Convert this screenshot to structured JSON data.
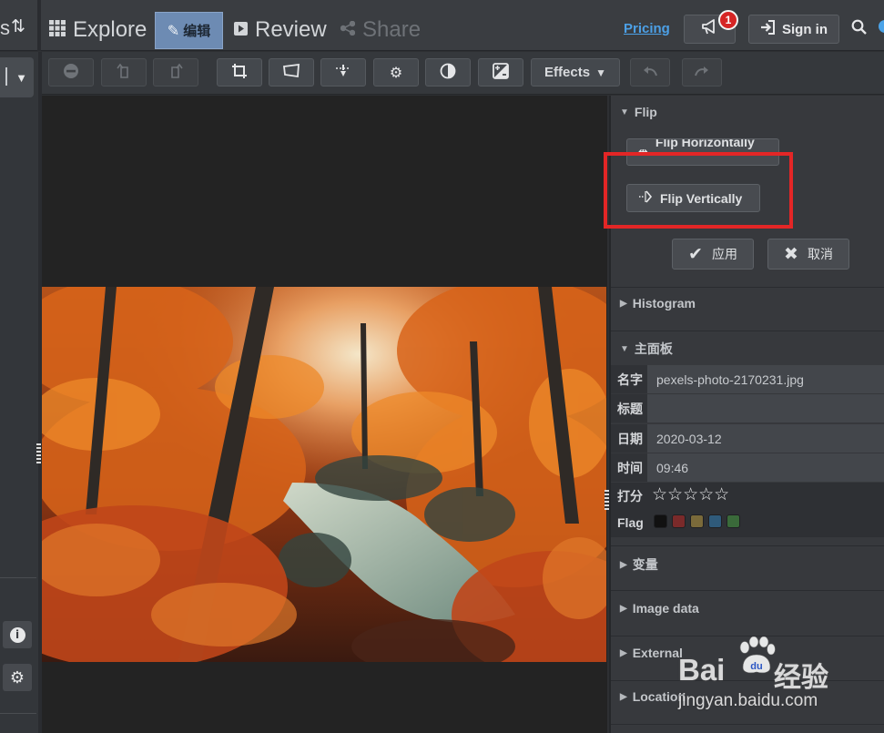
{
  "topbar": {
    "left_fragment": "s",
    "sort_icon": "sort-arrows-icon",
    "nav": [
      {
        "label": "Explore",
        "icon": "grid-icon"
      },
      {
        "label": "编辑",
        "icon": "pencil-icon"
      },
      {
        "label": "Review",
        "icon": "play-square-icon"
      },
      {
        "label": "Share",
        "icon": "share-icon"
      }
    ],
    "pricing": "Pricing",
    "notification_count": "1",
    "signin": "Sign in"
  },
  "toolbar": {
    "effects": "Effects"
  },
  "flip_panel": {
    "title": "Flip",
    "flip_horizontally": "Flip Horizontally",
    "flip_vertically": "Flip Vertically",
    "apply": "应用",
    "cancel": "取消"
  },
  "sections": {
    "histogram": "Histogram",
    "main_panel": "主面板",
    "variables": "变量",
    "image_data": "Image data",
    "external": "External",
    "location": "Location"
  },
  "metadata": {
    "name_label": "名字",
    "name_value": "pexels-photo-2170231.jpg",
    "title_label": "标题",
    "title_value": "",
    "date_label": "日期",
    "date_value": "2020-03-12",
    "time_label": "时间",
    "time_value": "09:46",
    "rating_label": "打分",
    "rating_stars": "☆☆☆☆☆",
    "rating_value": 0,
    "flag_label": "Flag",
    "flag_colors": [
      "#111111",
      "#7a2a2a",
      "#7a6a3a",
      "#2f5a7a",
      "#3a6a3a"
    ]
  },
  "watermark": {
    "brand_latin": "Bai",
    "brand_du": "du",
    "brand_cn": "经验",
    "url": "jingyan.baidu.com"
  },
  "colors": {
    "accent_blue": "#4ca0e6",
    "highlight_red": "#e32626",
    "edit_tab": "#6d8bb3"
  }
}
